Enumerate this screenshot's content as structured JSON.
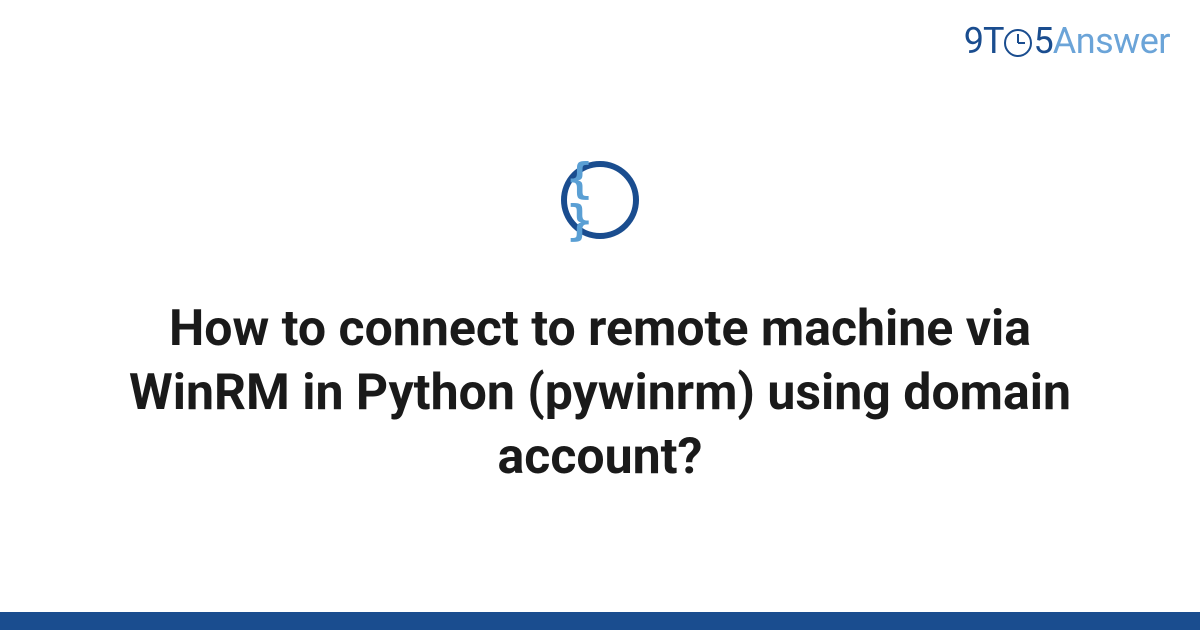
{
  "logo": {
    "part1": "9T",
    "part2": "5",
    "part3": "Answer"
  },
  "icon": {
    "braces": "{ }",
    "name": "code-braces-icon"
  },
  "title": "How to connect to remote machine via WinRM in Python (pywinrm) using domain account?",
  "colors": {
    "primary": "#1a4d8f",
    "accent": "#6ba4d8",
    "icon_fill": "#5a9fd4",
    "text": "#1a1a1a"
  }
}
